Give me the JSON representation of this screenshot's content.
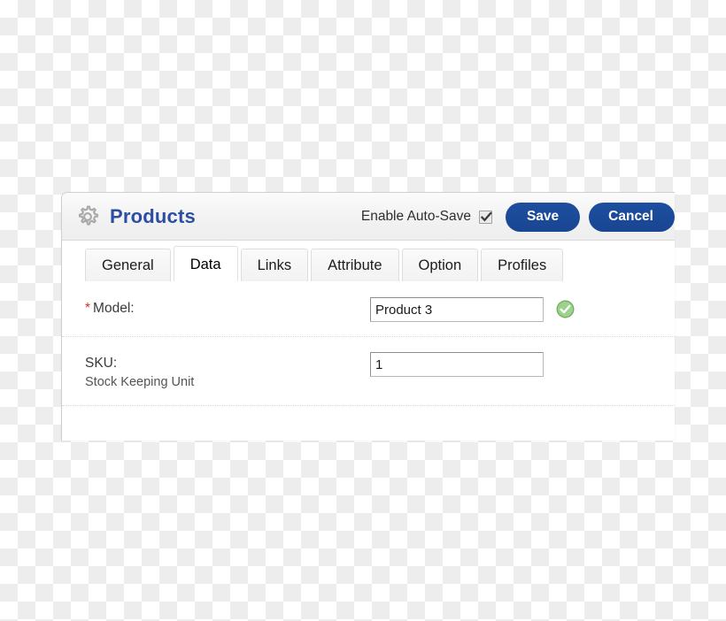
{
  "window": {
    "app_title": "Products",
    "gear_icon": "gear-icon"
  },
  "header": {
    "autosave_label": "Enable Auto-Save",
    "autosave_checked": true,
    "checkbox_icon": "checkmark-icon",
    "save_label": "Save",
    "cancel_label": "Cancel",
    "cancel_visible_text": "Can",
    "accent_blue": "#1a4a96",
    "title_color": "#2b4ea2"
  },
  "tabs": [
    {
      "label": "General",
      "active": false
    },
    {
      "label": "Data",
      "active": true
    },
    {
      "label": "Links",
      "active": false
    },
    {
      "label": "Attribute",
      "active": false
    },
    {
      "label": "Option",
      "active": false
    },
    {
      "label": "Profiles",
      "active": false
    }
  ],
  "form": {
    "rows": [
      {
        "required": true,
        "required_marker": "*",
        "label": "Model:",
        "sub_label": "",
        "value": "Product 3",
        "placeholder": "",
        "status_icon": "green-check-circle-icon",
        "status_color": "#8cc97f"
      },
      {
        "required": false,
        "required_marker": "",
        "label": "SKU:",
        "sub_label": "Stock Keeping Unit",
        "value": "1",
        "placeholder": "",
        "status_icon": "",
        "status_color": ""
      }
    ]
  }
}
